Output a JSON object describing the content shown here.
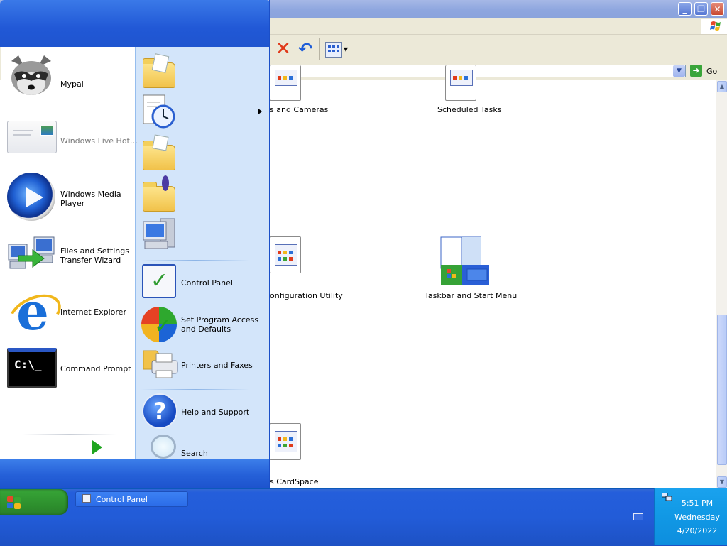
{
  "window": {
    "title_buttons": {
      "minimize": "_",
      "maximize": "❐",
      "close": "✕"
    },
    "address_go_label": "Go"
  },
  "control_panel_items": [
    {
      "label": "s and Cameras"
    },
    {
      "label": "Scheduled Tasks"
    },
    {
      "label": "onfiguration Utility"
    },
    {
      "label": "Taskbar and Start Menu"
    },
    {
      "label": "s CardSpace"
    }
  ],
  "start_menu": {
    "left_items": [
      {
        "label": "Mypal",
        "muted": false
      },
      {
        "label": "Windows Live Hot…",
        "muted": true
      },
      {
        "label": "Windows Media Player"
      },
      {
        "label": "Files and Settings Transfer Wizard"
      },
      {
        "label": "Internet Explorer"
      },
      {
        "label": "Command Prompt"
      }
    ],
    "cmd_text": "C:\\_",
    "right_items": [
      {
        "label": "Control Panel"
      },
      {
        "label": "Set Program Access and Defaults"
      },
      {
        "label": "Printers and Faxes"
      },
      {
        "label": "Help and Support"
      },
      {
        "label": "Search"
      }
    ]
  },
  "taskbar": {
    "task_label": "Control Panel",
    "clock_time": "5:51 PM",
    "clock_day": "Wednesday",
    "clock_date": "4/20/2022"
  },
  "colors": {
    "start_header": "#2158d6",
    "start_right_pane": "#d3e5fa",
    "taskbar": "#245edb",
    "tray": "#129ae6",
    "start_button": "#36a236"
  }
}
